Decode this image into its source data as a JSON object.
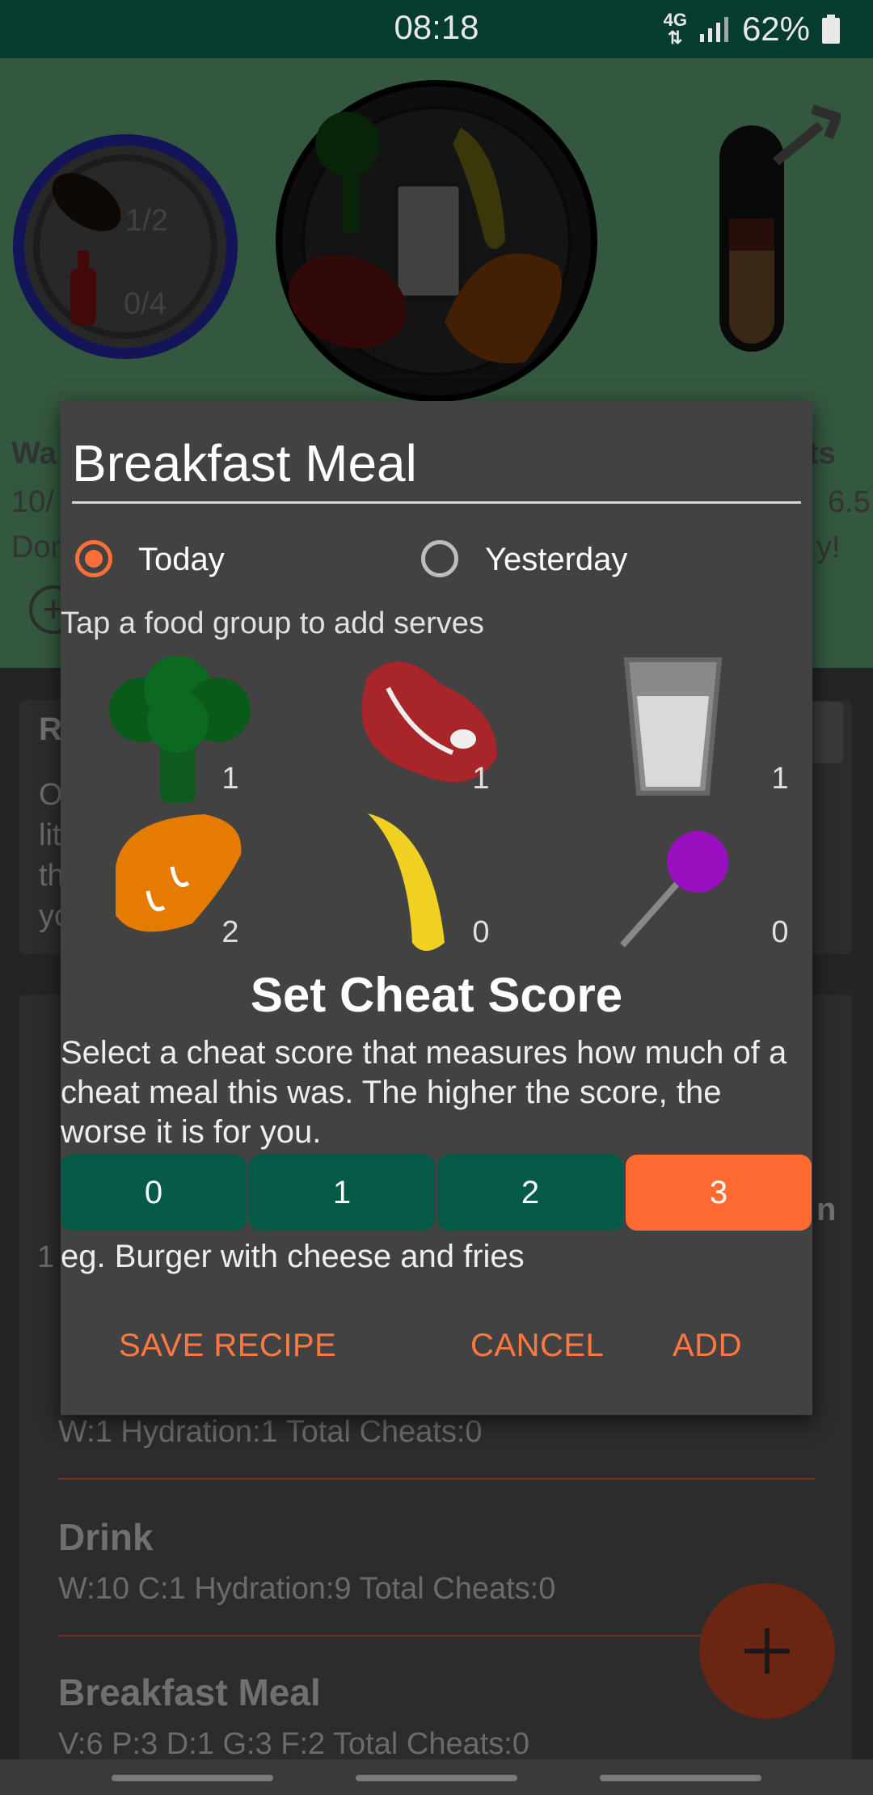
{
  "status_bar": {
    "time": "08:18",
    "network": "4G",
    "battery": "62%"
  },
  "tracker": {
    "treat_count": "1/2",
    "alcohol_count": "0/4",
    "bg_left_title": "Wa",
    "bg_left_line1": "10/",
    "bg_left_line2": "Dor",
    "bg_right_title": "ts",
    "bg_right_line1": "6.5",
    "bg_right_line2": "y!"
  },
  "background_list": {
    "tips_heading": "R",
    "tips_body": [
      "O",
      "lit",
      "th",
      "yo"
    ],
    "side_char": "1",
    "side_char_right": "n",
    "entries": [
      {
        "title": "",
        "line": "W:1   Hydration:1   Total Cheats:0"
      },
      {
        "title": "Drink",
        "line": "W:10   C:1   Hydration:9   Total Cheats:0"
      },
      {
        "title": "Breakfast Meal",
        "line": "V:6   P:3   D:1   G:3   F:2   Total Cheats:0"
      }
    ]
  },
  "dialog": {
    "meal_name": "Breakfast Meal",
    "radio_options": [
      "Today",
      "Yesterday"
    ],
    "selected_day": "Today",
    "hint": "Tap a food group to add serves",
    "food_groups": [
      {
        "name": "vegetables",
        "count": "1"
      },
      {
        "name": "protein",
        "count": "1"
      },
      {
        "name": "dairy",
        "count": "1"
      },
      {
        "name": "grains",
        "count": "2"
      },
      {
        "name": "fruit",
        "count": "0"
      },
      {
        "name": "treats",
        "count": "0"
      }
    ],
    "cheat_title": "Set Cheat Score",
    "cheat_description": "Select a cheat score that measures how much of a cheat meal this was. The higher the score, the worse it is for you.",
    "scores": [
      "0",
      "1",
      "2",
      "3"
    ],
    "selected_score": "3",
    "example": "eg. Burger with cheese and fries",
    "actions": {
      "save_recipe": "SAVE RECIPE",
      "cancel": "CANCEL",
      "add": "ADD"
    }
  },
  "colors": {
    "accent": "#ff6a32",
    "score_button": "#045a47",
    "status_bar": "#063c30",
    "dialog": "#424242"
  }
}
